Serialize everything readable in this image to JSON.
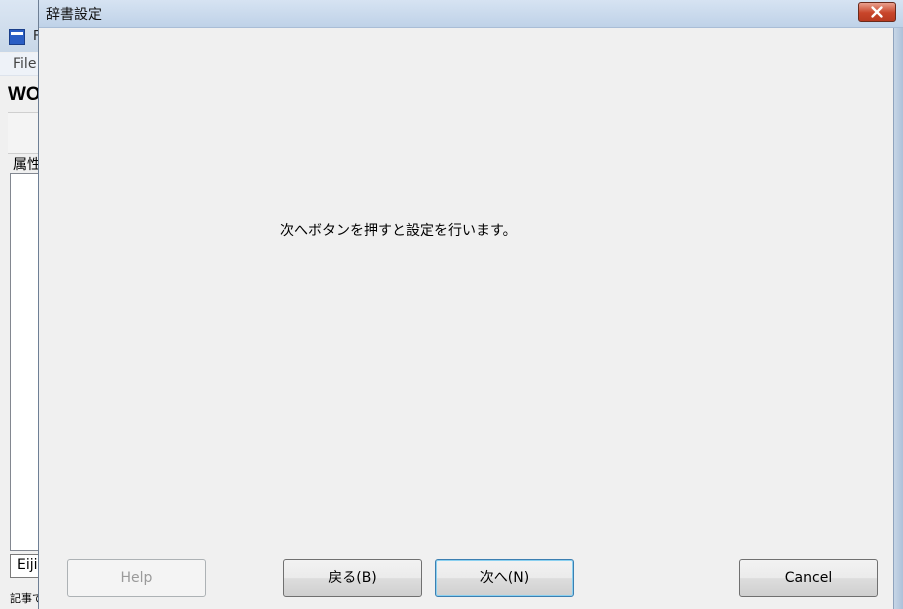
{
  "background_app": {
    "title_fragment": "F",
    "menu_file": "File",
    "header_fragment": "WO",
    "attribute_label_fragment": "属性",
    "combo_value_fragment": "Eiji",
    "status_fragment": "記事で"
  },
  "dialog": {
    "title": "辞書設定",
    "instruction": "次へボタンを押すと設定を行います。",
    "buttons": {
      "help": "Help",
      "back": "戻る(B)",
      "next": "次へ(N)",
      "cancel": "Cancel"
    }
  },
  "colors": {
    "close_button": "#c8452a",
    "dialog_background": "#f0f0f0",
    "title_bar": "#bfd2e8"
  },
  "icons": {
    "close": "close-icon",
    "app": "app-icon"
  }
}
